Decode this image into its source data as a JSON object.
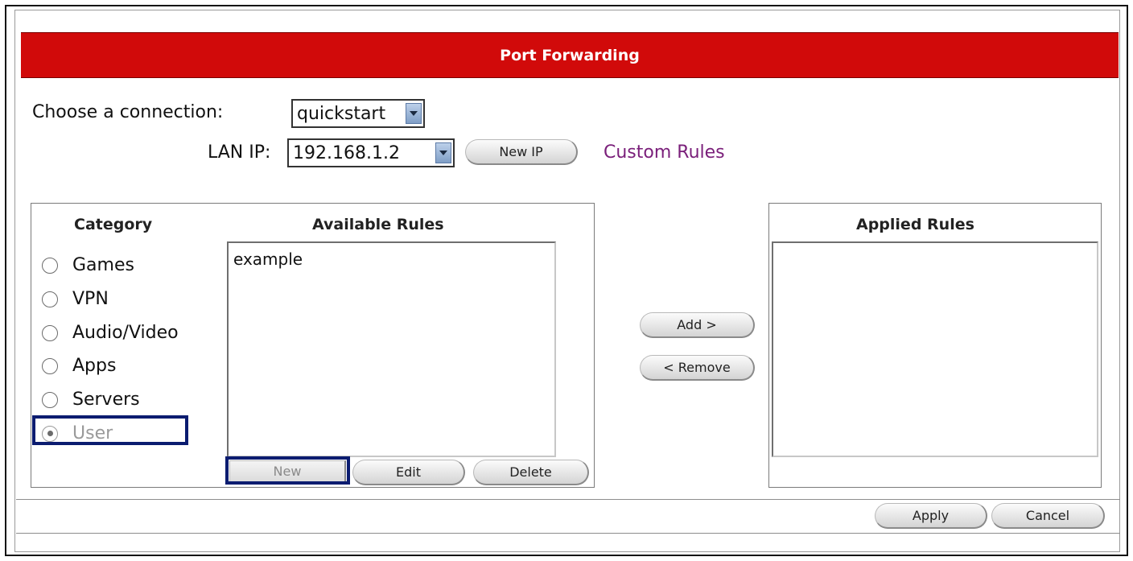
{
  "header": {
    "title": "Port Forwarding"
  },
  "connection": {
    "label": "Choose a connection:",
    "value": "quickstart"
  },
  "lan": {
    "label": "LAN IP:",
    "value": "192.168.1.2",
    "new_ip_label": "New IP",
    "custom_rules_label": "Custom Rules"
  },
  "category": {
    "heading": "Category",
    "options": [
      {
        "label": "Games",
        "checked": false
      },
      {
        "label": "VPN",
        "checked": false
      },
      {
        "label": "Audio/Video",
        "checked": false
      },
      {
        "label": "Apps",
        "checked": false
      },
      {
        "label": "Servers",
        "checked": false
      },
      {
        "label": "User",
        "checked": true
      }
    ]
  },
  "available_rules": {
    "heading": "Available Rules",
    "items": [
      "example"
    ],
    "new_label": "New",
    "edit_label": "Edit",
    "delete_label": "Delete"
  },
  "actions": {
    "add_label": "Add >",
    "remove_label": "< Remove"
  },
  "applied_rules": {
    "heading": "Applied Rules",
    "items": []
  },
  "footer": {
    "apply_label": "Apply",
    "cancel_label": "Cancel"
  },
  "colors": {
    "title_bar": "#d10a0a",
    "highlight": "#0b1c70",
    "link": "#7a1f7a"
  }
}
